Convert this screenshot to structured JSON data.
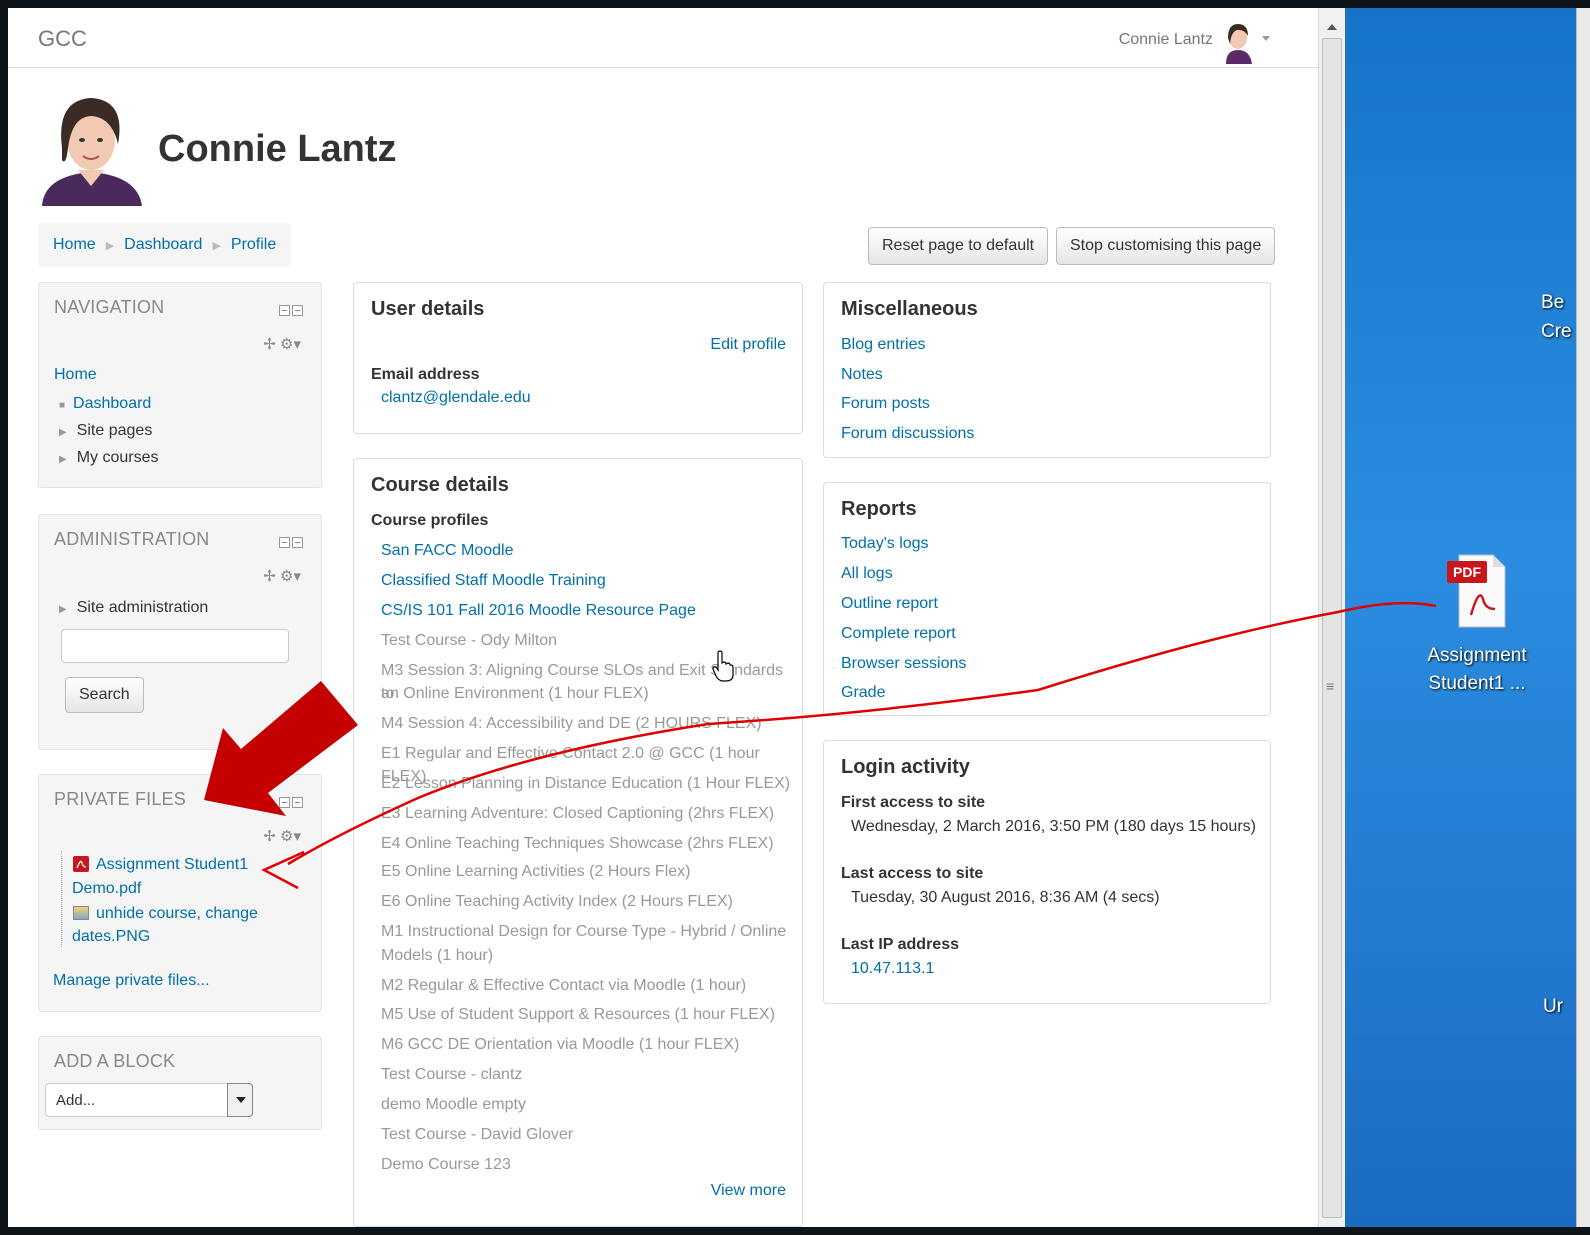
{
  "navbar": {
    "brand": "GCC",
    "user_name": "Connie Lantz"
  },
  "profile": {
    "full_name": "Connie Lantz"
  },
  "breadcrumb": [
    "Home",
    "Dashboard",
    "Profile"
  ],
  "buttons": {
    "reset": "Reset page to default",
    "stop": "Stop customising this page"
  },
  "navigation": {
    "title": "NAVIGATION",
    "home": "Home",
    "dashboard": "Dashboard",
    "site_pages": "Site pages",
    "my_courses": "My courses"
  },
  "administration": {
    "title": "ADMINISTRATION",
    "site_admin": "Site administration",
    "search_value": "",
    "search_button": "Search"
  },
  "private_files": {
    "title": "PRIVATE FILES",
    "file1_line1": "Assignment Student1",
    "file1_line2": "Demo.pdf",
    "file2_line1": "unhide course, change",
    "file2_line2": "dates.PNG",
    "manage": "Manage private files..."
  },
  "add_block": {
    "title": "ADD A BLOCK",
    "selected": "Add..."
  },
  "user_details": {
    "title": "User details",
    "edit_profile": "Edit profile",
    "email_label": "Email address",
    "email": "clantz@glendale.edu"
  },
  "course_details": {
    "title": "Course details",
    "profiles_label": "Course profiles",
    "courses": [
      {
        "name": "San FACC Moodle",
        "visible": true
      },
      {
        "name": "Classified Staff Moodle Training",
        "visible": true
      },
      {
        "name": "CS/IS 101 Fall 2016 Moodle Resource Page",
        "visible": true
      },
      {
        "name": "Test Course - Ody Milton",
        "visible": false
      },
      {
        "name": "M3 Session 3: Aligning Course SLOs and Exit Standards to",
        "visible": false
      },
      {
        "name": "an Online Environment (1 hour FLEX)",
        "visible": false
      },
      {
        "name": "M4 Session 4: Accessibility and DE (2 HOURS FLEX)",
        "visible": false
      },
      {
        "name": "E1 Regular and Effective Contact 2.0 @ GCC (1 hour FLEX)",
        "visible": false
      },
      {
        "name": "E2 Lesson Planning in Distance Education (1 Hour FLEX)",
        "visible": false
      },
      {
        "name": "E3 Learning Adventure: Closed Captioning (2hrs FLEX)",
        "visible": false
      },
      {
        "name": "E4 Online Teaching Techniques Showcase (2hrs FLEX)",
        "visible": false
      },
      {
        "name": "E5 Online Learning Activities (2 Hours Flex)",
        "visible": false
      },
      {
        "name": "E6 Online Teaching Activity Index (2 Hours FLEX)",
        "visible": false
      },
      {
        "name": "M1 Instructional Design for Course Type - Hybrid / Online",
        "visible": false
      },
      {
        "name": "Models (1 hour)",
        "visible": false
      },
      {
        "name": "M2 Regular & Effective Contact via Moodle (1 hour)",
        "visible": false
      },
      {
        "name": "M5 Use of Student Support & Resources (1 hour FLEX)",
        "visible": false
      },
      {
        "name": "M6 GCC DE Orientation via Moodle (1 hour FLEX)",
        "visible": false
      },
      {
        "name": "Test Course - clantz",
        "visible": false
      },
      {
        "name": "demo Moodle empty",
        "visible": false
      },
      {
        "name": "Test Course - David Glover",
        "visible": false
      },
      {
        "name": "Demo Course 123",
        "visible": false
      }
    ],
    "view_more": "View more"
  },
  "miscellaneous": {
    "title": "Miscellaneous",
    "links": [
      "Blog entries",
      "Notes",
      "Forum posts",
      "Forum discussions"
    ]
  },
  "reports": {
    "title": "Reports",
    "links": [
      "Today's logs",
      "All logs",
      "Outline report",
      "Complete report",
      "Browser sessions",
      "Grade"
    ]
  },
  "login_activity": {
    "title": "Login activity",
    "first_label": "First access to site",
    "first_value": "Wednesday, 2 March 2016, 3:50 PM  (180 days 15 hours)",
    "last_label": "Last access to site",
    "last_value": "Tuesday, 30 August 2016, 8:36 AM  (4 secs)",
    "ip_label": "Last IP address",
    "ip_value": "10.47.113.1"
  },
  "desktop": {
    "pdf_badge": "PDF",
    "icon_line1": "Assignment",
    "icon_line2": "Student1 ...",
    "edge_text_1": "Be",
    "edge_text_2": "Cre",
    "edge_text_3": "Ur"
  },
  "colors": {
    "link": "#0070a8",
    "annotation": "#d00000",
    "desktop": "#1a7ad0"
  }
}
